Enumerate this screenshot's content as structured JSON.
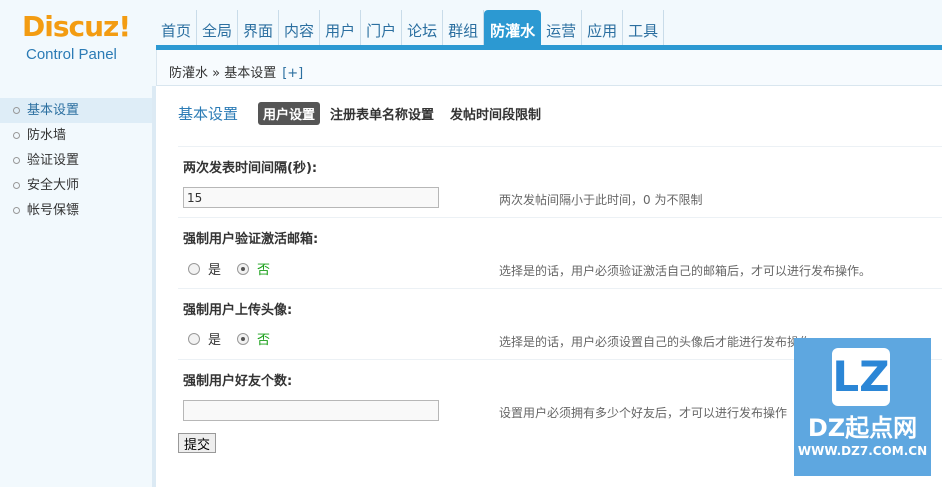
{
  "logo": {
    "mark": "Discuz!",
    "subtitle": "Control Panel"
  },
  "nav": [
    {
      "label": "首页",
      "active": false
    },
    {
      "label": "全局",
      "active": false
    },
    {
      "label": "界面",
      "active": false
    },
    {
      "label": "内容",
      "active": false
    },
    {
      "label": "用户",
      "active": false
    },
    {
      "label": "门户",
      "active": false
    },
    {
      "label": "论坛",
      "active": false
    },
    {
      "label": "群组",
      "active": false
    },
    {
      "label": "防灌水",
      "active": true
    },
    {
      "label": "运营",
      "active": false
    },
    {
      "label": "应用",
      "active": false
    },
    {
      "label": "工具",
      "active": false
    }
  ],
  "breadcrumb": {
    "text": "防灌水 » 基本设置",
    "add": "[+]"
  },
  "sidebar": {
    "items": [
      {
        "label": "基本设置",
        "active": true
      },
      {
        "label": "防水墙",
        "active": false
      },
      {
        "label": "验证设置",
        "active": false
      },
      {
        "label": "安全大师",
        "active": false
      },
      {
        "label": "帐号保镖",
        "active": false
      }
    ]
  },
  "main": {
    "title": "基本设置",
    "tabs": [
      {
        "label": "用户设置",
        "active": true
      },
      {
        "label": "注册表单名称设置",
        "active": false
      },
      {
        "label": "发帖时间段限制",
        "active": false
      }
    ],
    "fields": {
      "interval": {
        "label": "两次发表时间间隔(秒):",
        "value": "15",
        "tip": "两次发帖间隔小于此时间，0 为不限制"
      },
      "email": {
        "label": "强制用户验证激活邮箱:",
        "yes": "是",
        "no": "否",
        "tip": "选择是的话，用户必须验证激活自己的邮箱后，才可以进行发布操作。"
      },
      "avatar": {
        "label": "强制用户上传头像:",
        "yes": "是",
        "no": "否",
        "tip": "选择是的话，用户必须设置自己的头像后才能进行发布操作"
      },
      "friends": {
        "label": "强制用户好友个数:",
        "value": "",
        "tip": "设置用户必须拥有多少个好友后，才可以进行发布操作"
      }
    },
    "submit": "提交"
  },
  "watermark": {
    "mark": "LZ",
    "title": "DZ起点网",
    "url": "WWW.DZ7.COM.CN"
  }
}
